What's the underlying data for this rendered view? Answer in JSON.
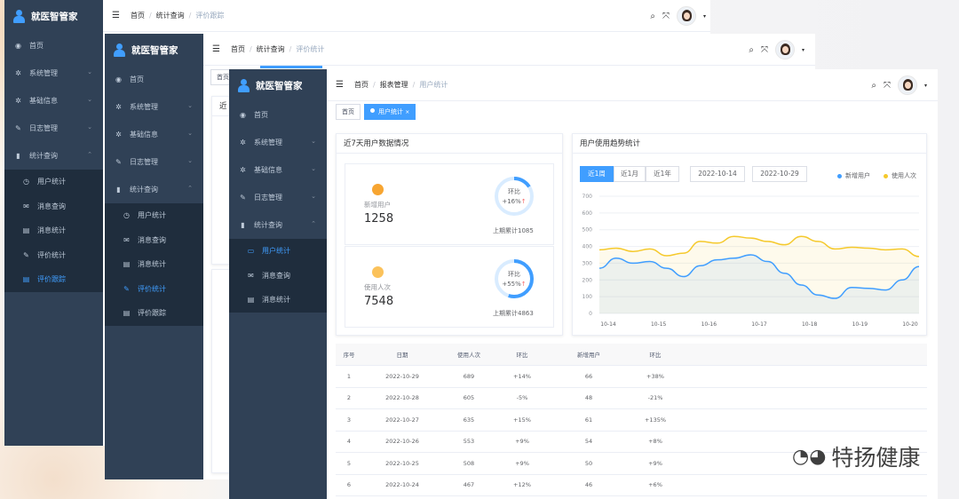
{
  "brand": "就医智管家",
  "breadcrumb_root": "首页",
  "w1": {
    "crumb1": "统计查询",
    "crumb2": "评价跟踪",
    "menu": [
      {
        "icon": "dashboard-icon",
        "label": "首页"
      },
      {
        "icon": "gear-icon",
        "label": "系统管理"
      },
      {
        "icon": "gear-icon",
        "label": "基础信息"
      },
      {
        "icon": "edit-icon",
        "label": "日志管理"
      },
      {
        "icon": "chart-icon",
        "label": "统计查询"
      }
    ],
    "sub": [
      {
        "icon": "clock-icon",
        "label": "用户统计"
      },
      {
        "icon": "mail-icon",
        "label": "消息查询"
      },
      {
        "icon": "doc-icon",
        "label": "消息统计"
      },
      {
        "icon": "edit-icon",
        "label": "评价统计"
      },
      {
        "icon": "doc-icon",
        "label": "评价跟踪"
      }
    ]
  },
  "w2": {
    "crumb1": "统计查询",
    "crumb2": "评价统计",
    "sub": [
      {
        "icon": "clock-icon",
        "label": "用户统计"
      },
      {
        "icon": "mail-icon",
        "label": "消息查询"
      },
      {
        "icon": "doc-icon",
        "label": "消息统计"
      },
      {
        "icon": "edit-icon",
        "label": "评价统计"
      },
      {
        "icon": "doc-icon",
        "label": "评价跟踪"
      }
    ],
    "tag_home": "首页",
    "card_label": "近"
  },
  "w3": {
    "crumb1": "报表管理",
    "crumb2": "用户统计",
    "sub": [
      {
        "icon": "monitor-icon",
        "label": "用户统计"
      },
      {
        "icon": "mail-icon",
        "label": "消息查询"
      },
      {
        "icon": "doc-icon",
        "label": "消息统计"
      }
    ],
    "tags": [
      "首页",
      "用户统计"
    ]
  },
  "stats": {
    "title": "近7天用户数据情况",
    "items": [
      {
        "label": "新增用户",
        "value": "1258",
        "ratio_label": "环比",
        "ratio": "+16%",
        "ratio_value": 0.16,
        "accum": "上期累计1085"
      },
      {
        "label": "使用人次",
        "value": "7548",
        "ratio_label": "环比",
        "ratio": "+55%",
        "ratio_value": 0.55,
        "accum": "上期累计4863"
      }
    ]
  },
  "trend": {
    "title": "用户使用趋势统计",
    "ranges": [
      "近1周",
      "近1月",
      "近1年"
    ],
    "date_from": "2022-10-14",
    "date_to": "2022-10-29",
    "legend": [
      {
        "name": "新增用户",
        "color": "#409eff"
      },
      {
        "name": "使用人次",
        "color": "#f5c92c"
      }
    ]
  },
  "chart_data": {
    "type": "line",
    "x": [
      "10-14",
      "10-15",
      "10-16",
      "10-17",
      "10-18",
      "10-19",
      "10-20"
    ],
    "ylim": [
      0,
      700
    ],
    "yticks": [
      0,
      100,
      200,
      300,
      400,
      500,
      600,
      700
    ],
    "series": [
      {
        "name": "新增用户",
        "color": "#409eff",
        "values": [
          270,
          330,
          300,
          310,
          270,
          220,
          285,
          320,
          330,
          350,
          310,
          240,
          170,
          110,
          90,
          155,
          150,
          140,
          200,
          280
        ]
      },
      {
        "name": "使用人次",
        "color": "#f5c92c",
        "values": [
          380,
          390,
          370,
          385,
          345,
          360,
          430,
          420,
          460,
          450,
          430,
          410,
          460,
          430,
          385,
          395,
          390,
          380,
          385,
          340
        ]
      }
    ],
    "grid": true,
    "legend_position": "top-right"
  },
  "table": {
    "headers": [
      "序号",
      "日期",
      "使用人次",
      "环比",
      "新增用户",
      "环比"
    ],
    "rows": [
      [
        "1",
        "2022-10-29",
        "689",
        "+14%",
        "66",
        "+38%"
      ],
      [
        "2",
        "2022-10-28",
        "605",
        "-5%",
        "48",
        "-21%"
      ],
      [
        "3",
        "2022-10-27",
        "635",
        "+15%",
        "61",
        "+135%"
      ],
      [
        "4",
        "2022-10-26",
        "553",
        "+9%",
        "54",
        "+8%"
      ],
      [
        "5",
        "2022-10-25",
        "508",
        "+9%",
        "50",
        "+9%"
      ],
      [
        "6",
        "2022-10-24",
        "467",
        "+12%",
        "46",
        "+6%"
      ]
    ]
  },
  "watermark": "特扬健康"
}
